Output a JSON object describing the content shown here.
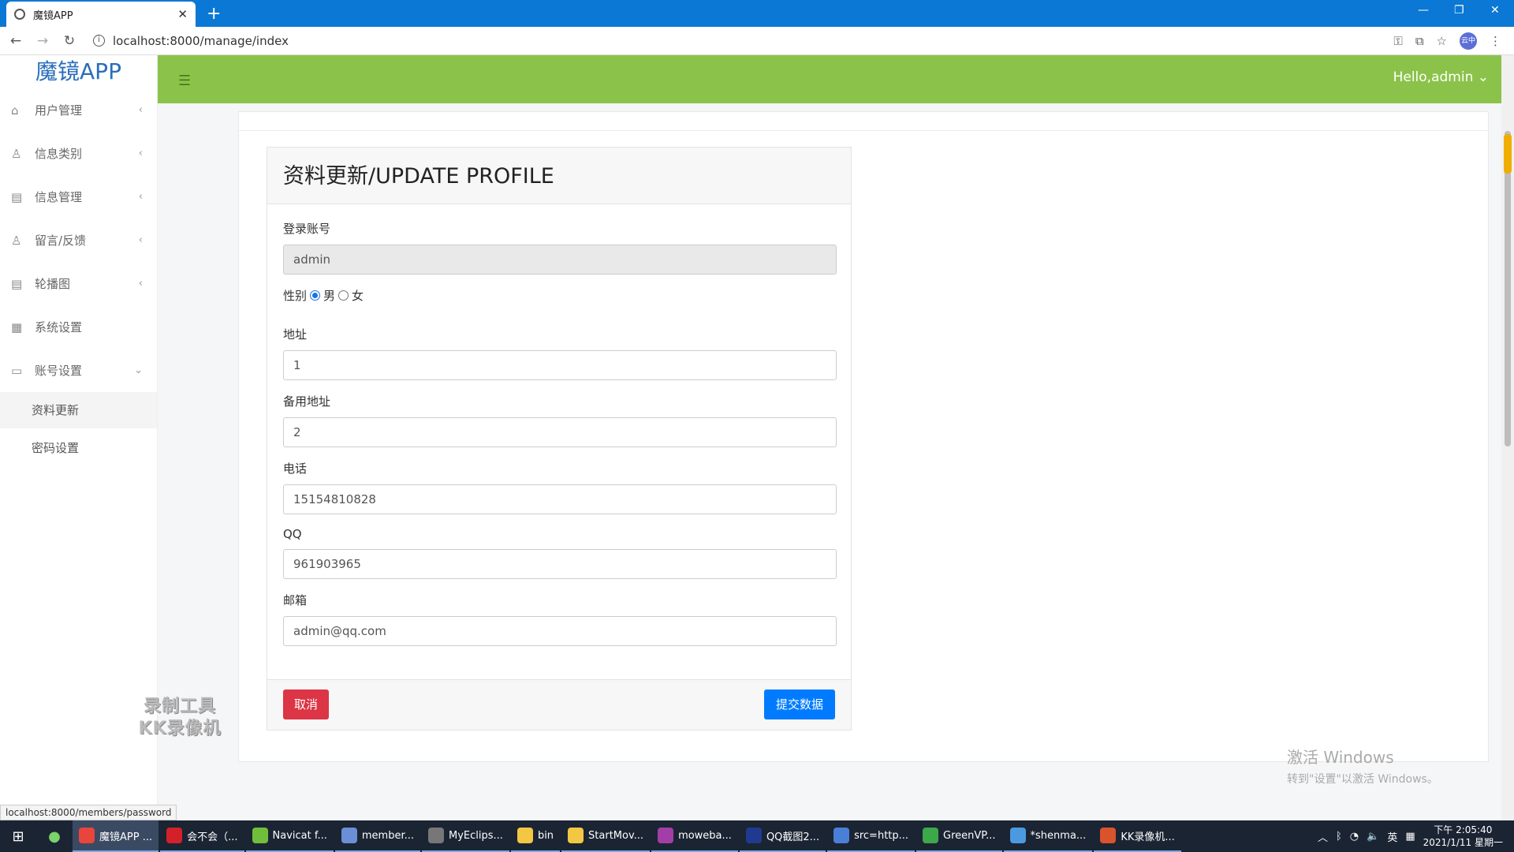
{
  "browser": {
    "tab_title": "魔镜APP",
    "url": "localhost:8000/manage/index",
    "profile_label": "云中",
    "status_url": "localhost:8000/members/password"
  },
  "sidebar": {
    "brand": "魔镜APP",
    "items": [
      {
        "label": "用户管理",
        "icon": "home-icon"
      },
      {
        "label": "信息类别",
        "icon": "user-icon"
      },
      {
        "label": "信息管理",
        "icon": "document-icon"
      },
      {
        "label": "留言/反馈",
        "icon": "user-icon"
      },
      {
        "label": "轮播图",
        "icon": "document-icon"
      },
      {
        "label": "系统设置",
        "icon": "settings-icon"
      },
      {
        "label": "账号设置",
        "icon": "folder-icon"
      }
    ],
    "submenu": [
      {
        "label": "资料更新"
      },
      {
        "label": "密码设置"
      }
    ]
  },
  "header": {
    "greeting": "Hello,admin"
  },
  "form": {
    "title": "资料更新/UPDATE PROFILE",
    "account_label": "登录账号",
    "account_value": "admin",
    "gender_label": "性别",
    "gender_male": "男",
    "gender_female": "女",
    "gender_selected": "男",
    "address_label": "地址",
    "address_value": "1",
    "alt_address_label": "备用地址",
    "alt_address_value": "2",
    "phone_label": "电话",
    "phone_value": "15154810828",
    "qq_label": "QQ",
    "qq_value": "961903965",
    "email_label": "邮箱",
    "email_value": "admin@qq.com",
    "cancel_label": "取消",
    "submit_label": "提交数据"
  },
  "watermarks": {
    "recorder_line1": "录制工具",
    "recorder_line2": "KK录像机",
    "activate_title": "激活 Windows",
    "activate_sub": "转到\"设置\"以激活 Windows。"
  },
  "taskbar": {
    "apps": [
      {
        "label": "魔镜APP ...",
        "color": "#e8453c"
      },
      {
        "label": "会不会（...",
        "color": "#d4202a"
      },
      {
        "label": "Navicat f...",
        "color": "#6fbf3b"
      },
      {
        "label": "member...",
        "color": "#6a8fd6"
      },
      {
        "label": "MyEclips...",
        "color": "#777777"
      },
      {
        "label": "bin",
        "color": "#f2c744"
      },
      {
        "label": "StartMov...",
        "color": "#f2c744"
      },
      {
        "label": "moweba...",
        "color": "#a33ea8"
      },
      {
        "label": "QQ截图2...",
        "color": "#1f3a8f"
      },
      {
        "label": "src=http...",
        "color": "#4a7fd8"
      },
      {
        "label": "GreenVP...",
        "color": "#3ca84a"
      },
      {
        "label": "*shenma...",
        "color": "#4b9ae0"
      },
      {
        "label": "KK录像机...",
        "color": "#d9532c"
      }
    ],
    "ime": "英",
    "time": "下午 2:05:40",
    "date": "2021/1/11 星期一"
  },
  "colors": {
    "header_green": "#8bc34a",
    "brand_blue": "#2a6ebb",
    "cancel_red": "#dc3545",
    "submit_blue": "#007bff"
  }
}
